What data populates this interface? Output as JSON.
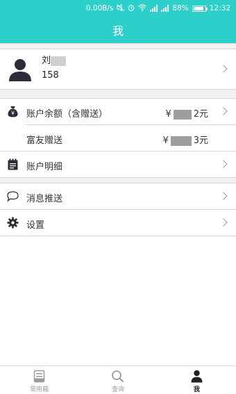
{
  "status_bar": {
    "net_speed": "0.00B/s",
    "battery": "88%",
    "battery_level": 0.88,
    "time": "12:32",
    "icons": [
      "mute-icon",
      "alarm-icon",
      "wifi-icon",
      "signal-icon",
      "signal-icon",
      "battery-icon"
    ]
  },
  "header": {
    "title": "我"
  },
  "profile": {
    "name": "刘",
    "phone": "158"
  },
  "menu": {
    "balance": {
      "label": "账户余额（含赠送）",
      "value_prefix": "¥",
      "value_suffix": "2元",
      "icon": "money-bag-icon"
    },
    "gift": {
      "label": "富友赠送",
      "value_prefix": "¥",
      "value_suffix": "3元"
    },
    "detail": {
      "label": "账户明细",
      "icon": "notepad-icon"
    },
    "messages": {
      "label": "消息推送",
      "icon": "chat-bubble-icon"
    },
    "settings": {
      "label": "设置",
      "icon": "gear-icon"
    }
  },
  "tabbar": {
    "tabs": [
      {
        "label": "常用箱",
        "icon": "box-icon",
        "active": false
      },
      {
        "label": "查询",
        "icon": "search-icon",
        "active": false
      },
      {
        "label": "我",
        "icon": "person-icon",
        "active": true
      }
    ]
  },
  "colors": {
    "accent": "#2ccfc9",
    "icon_dark": "#2b2b3a"
  }
}
